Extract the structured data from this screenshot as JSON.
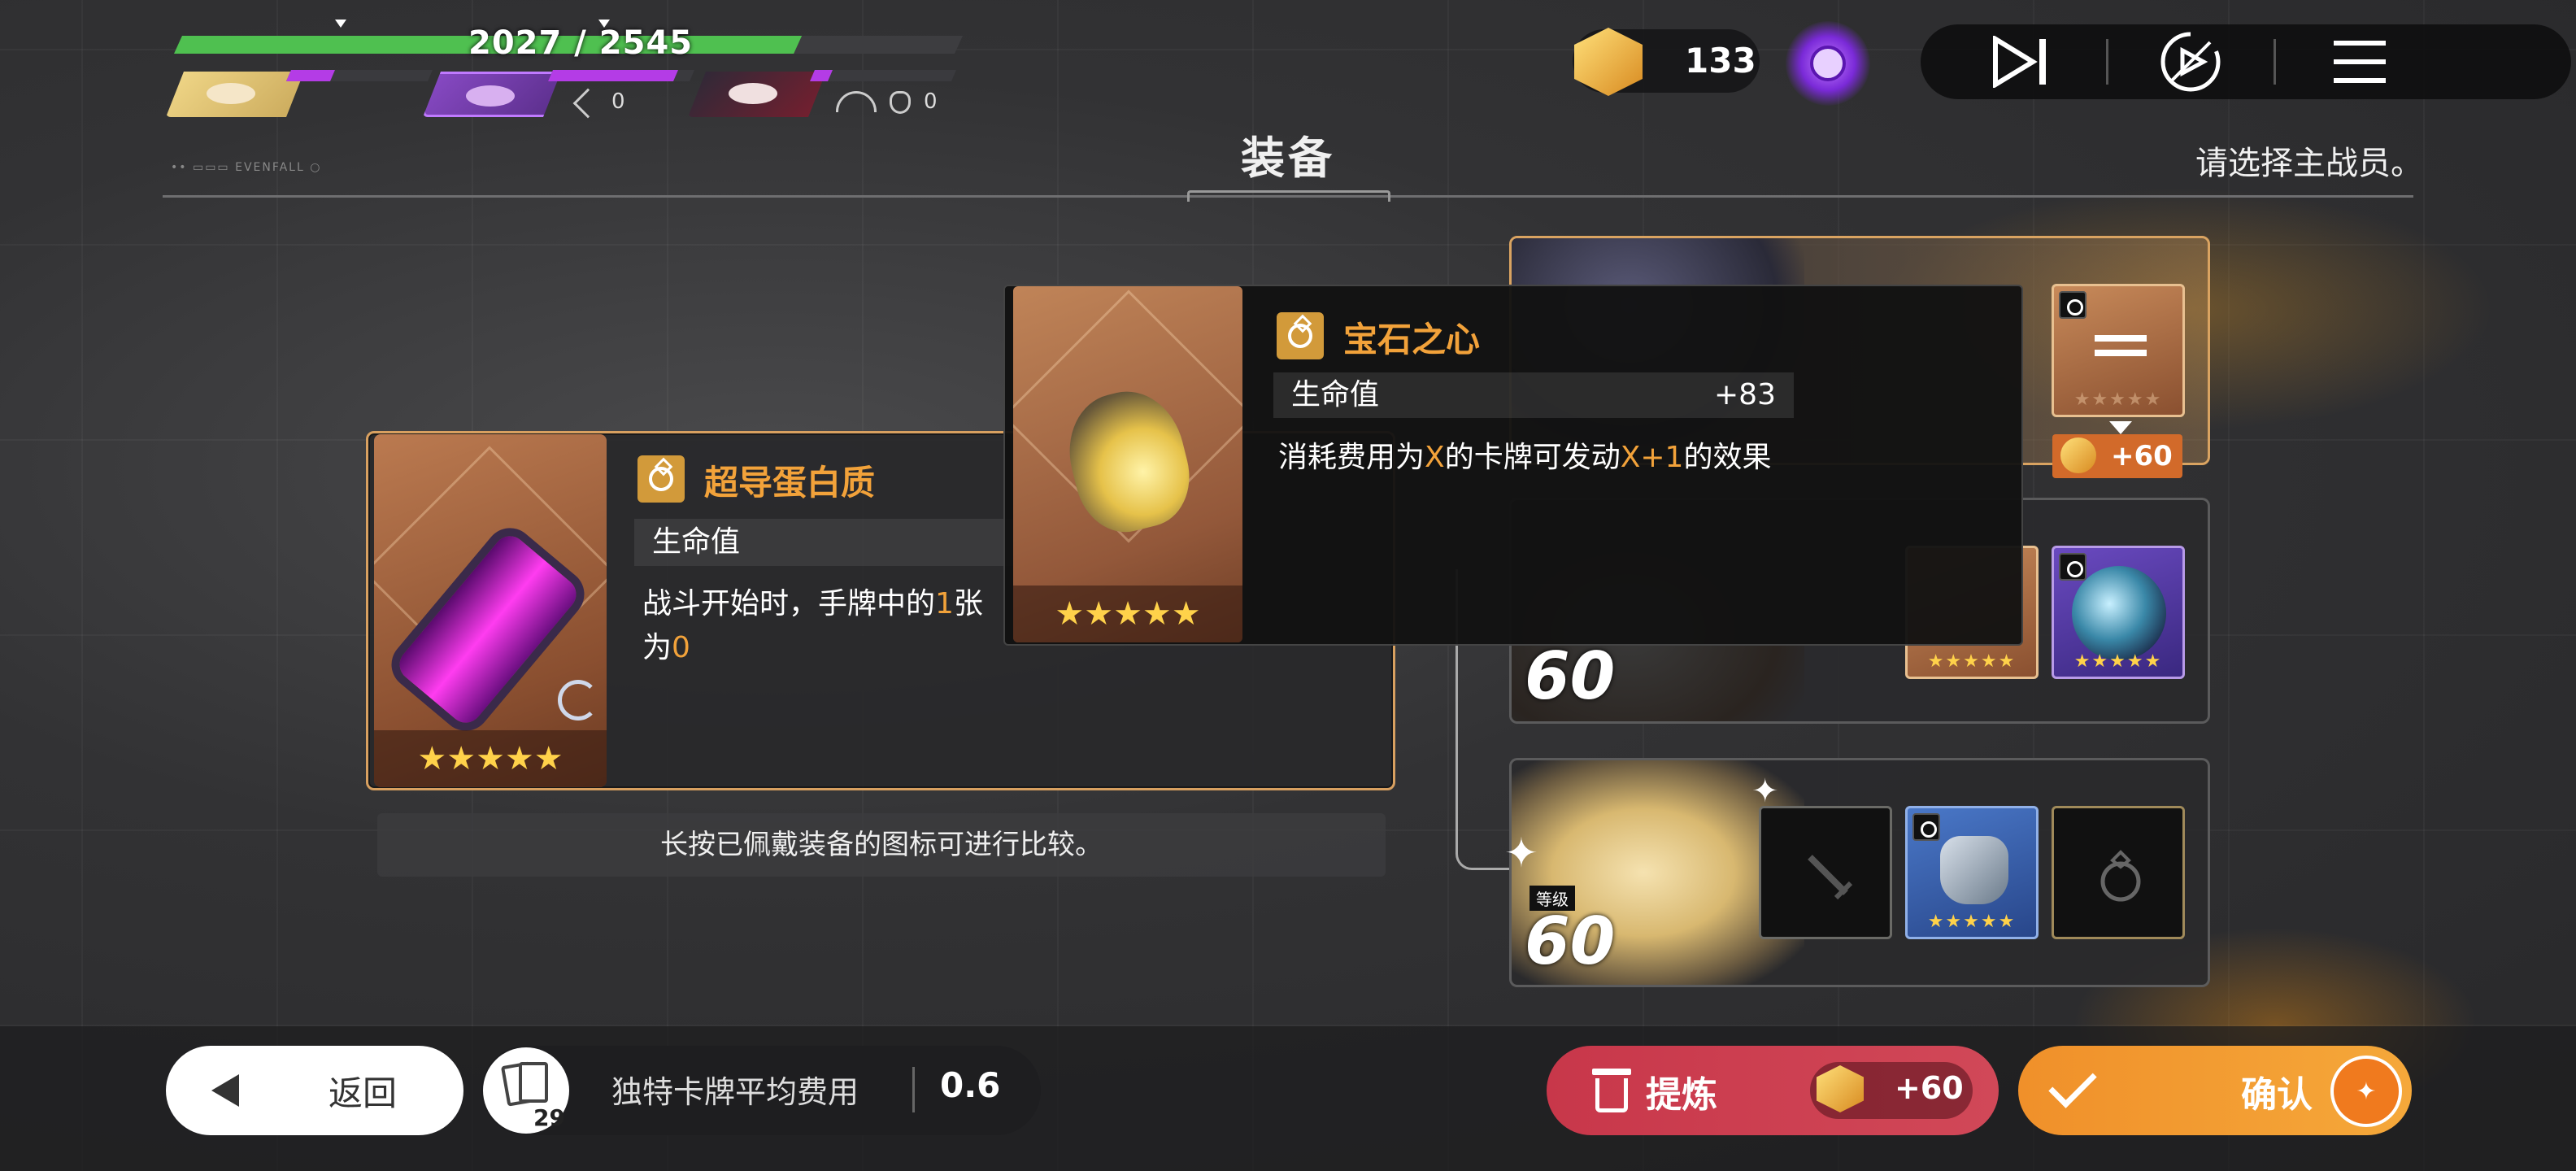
{
  "party": {
    "hp_text": "2027 / 2545",
    "hp_fraction": 0.796,
    "members": [
      {
        "name": "blonde-girl",
        "energy_fraction": 0.4
      },
      {
        "name": "purple-hair",
        "energy_fraction": 0.9,
        "count": "0"
      },
      {
        "name": "dark-hair",
        "energy_fraction": 0.15,
        "count": "0"
      }
    ]
  },
  "hud": {
    "currency_value": "133"
  },
  "screen": {
    "title": "装备",
    "hint": "请选择主战员。"
  },
  "left_equip": {
    "name": "超导蛋白质",
    "stat_label": "生命值",
    "desc_part1": "战斗开始时，手牌中的",
    "desc_hl1": "1",
    "desc_part2": "张",
    "desc_part3": "为",
    "desc_hl2": "0",
    "stars": "★★★★★"
  },
  "popup_equip": {
    "name": "宝石之心",
    "stat_label": "生命值",
    "stat_value": "+83",
    "desc_part1": "消耗费用为",
    "desc_hl1": "X",
    "desc_part2": "的卡牌可发动",
    "desc_hl2": "X+1",
    "desc_part3": "的效果",
    "stars": "★★★★★"
  },
  "compare_hint": "长按已佩戴装备的图标可进行比较。",
  "characters": [
    {
      "level": "",
      "bonus": "+60",
      "stars_dim": "★★★★★"
    },
    {
      "level": "60",
      "stars_orange": "★★★★★",
      "stars_purple": "★★★★★"
    },
    {
      "level_tag": "等级",
      "level": "60",
      "stars_blue": "★★★★★"
    }
  ],
  "bottom": {
    "back_label": "返回",
    "deck_count": "29",
    "deck_label": "独特卡牌平均费用",
    "deck_value": "0.6",
    "refine_label": "提炼",
    "refine_value": "+60",
    "confirm_label": "确认",
    "confirm_badge": "✦"
  },
  "colors": {
    "accent_orange": "#f2a23a",
    "hp_green": "#4fc050",
    "energy_purple": "#b43ce6",
    "refine_red": "#c8374a",
    "confirm_orange": "#f0902a"
  }
}
